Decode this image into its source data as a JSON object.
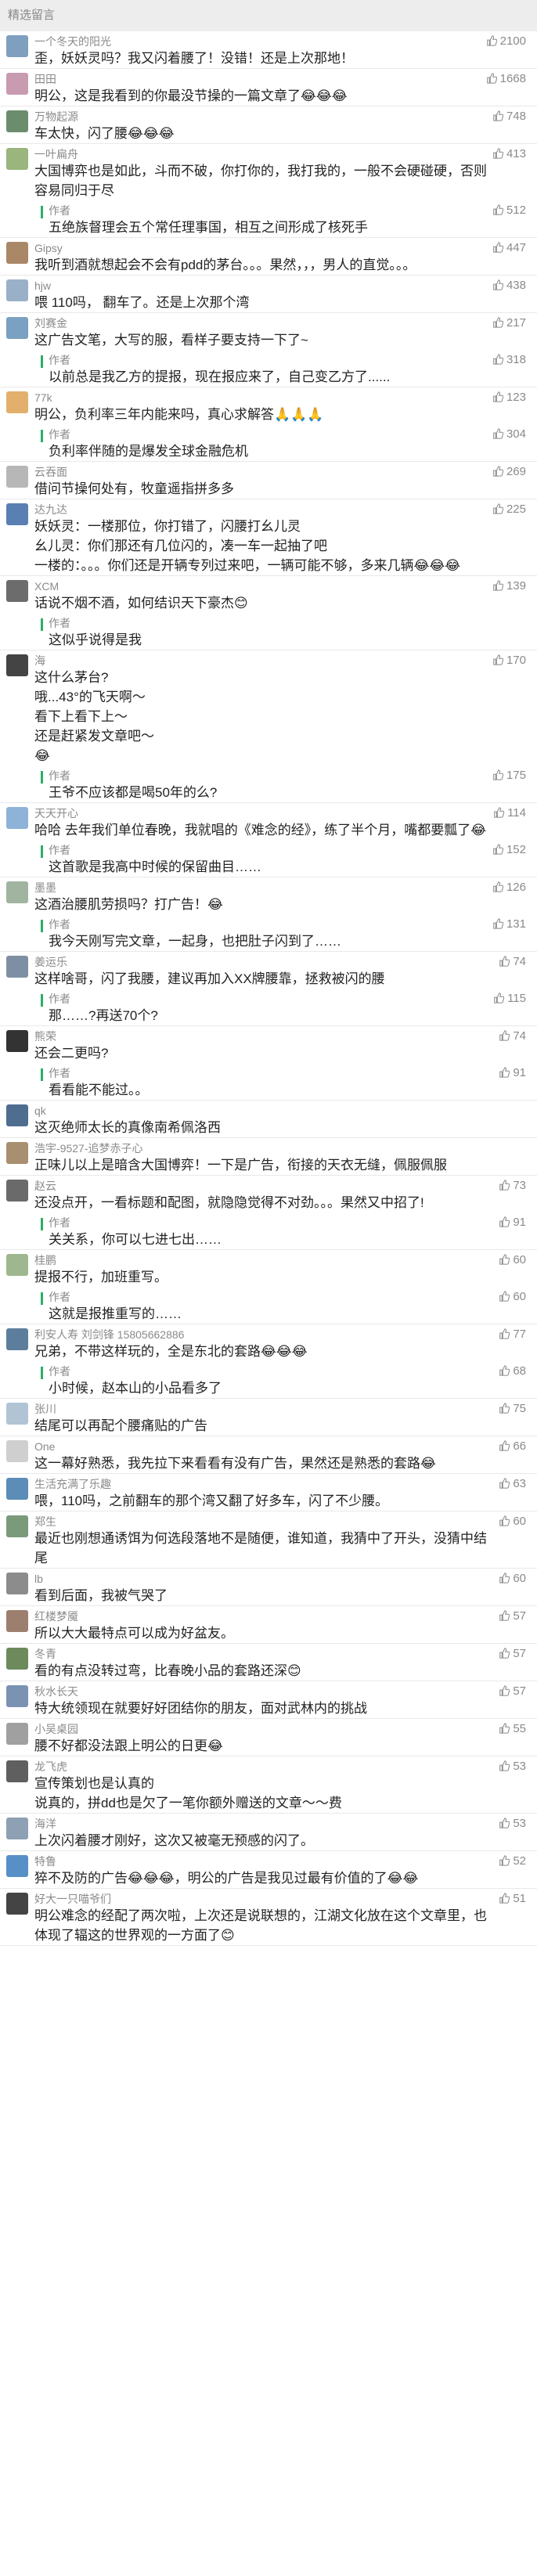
{
  "header": {
    "title": "精选留言"
  },
  "reply_label": "作者",
  "comments": [
    {
      "name": "一个冬天的阳光",
      "likes": "2100",
      "text": "歪，妖妖灵吗？我又闪着腰了！没错！还是上次那地！",
      "avatar": "#7f9fbf"
    },
    {
      "name": "田田",
      "likes": "1668",
      "text": "明公，这是我看到的你最没节操的一篇文章了😂😂😂",
      "avatar": "#c89bb0"
    },
    {
      "name": "万物起源",
      "likes": "748",
      "text": "车太快，闪了腰😂😂😂",
      "avatar": "#6b8d6d"
    },
    {
      "name": "一叶扁舟",
      "likes": "413",
      "text": "大国博弈也是如此，斗而不破，你打你的，我打我的，一般不会硬碰硬，否则容易同归于尽",
      "avatar": "#9ab57d",
      "reply": {
        "likes": "512",
        "text": "五绝族督理会五个常任理事国，相互之间形成了核死手"
      }
    },
    {
      "name": "Gipsy",
      "likes": "447",
      "text": "我听到酒就想起会不会有pdd的茅台。。。果然，，，男人的直觉。。。",
      "avatar": "#aa8766"
    },
    {
      "name": "hjw",
      "likes": "438",
      "text": "喂 110吗， 翻车了。还是上次那个湾",
      "avatar": "#9ab0c8"
    },
    {
      "name": "刘赛金",
      "likes": "217",
      "text": "这广告文笔，大写的服，看样子要支持一下了~",
      "avatar": "#7aa0c2",
      "reply": {
        "likes": "318",
        "text": "以前总是我乙方的提报，现在报应来了，自己变乙方了......"
      }
    },
    {
      "name": "77k",
      "likes": "123",
      "text": "明公，负利率三年内能来吗，真心求解答🙏🙏🙏",
      "avatar": "#e2b06c",
      "reply": {
        "likes": "304",
        "text": "负利率伴随的是爆发全球金融危机"
      }
    },
    {
      "name": "云吞面",
      "likes": "269",
      "text": "借问节操何处有，牧童遥指拼多多",
      "avatar": "#b7b7b7"
    },
    {
      "name": "达九达",
      "likes": "225",
      "text": "妖妖灵：一楼那位，你打错了，闪腰打幺儿灵\n幺儿灵：你们那还有几位闪的，凑一车一起抽了吧\n一楼的：。。。你们还是开辆专列过来吧，一辆可能不够，多来几辆😂😂😂",
      "avatar": "#5a7fb3"
    },
    {
      "name": "XCM",
      "likes": "139",
      "text": "话说不烟不酒，如何结识天下豪杰😊",
      "avatar": "#6c6c6c",
      "reply": {
        "likes": "",
        "text": "这似乎说得是我"
      }
    },
    {
      "name": "海",
      "likes": "170",
      "text": "这什么茅台?\n哦...43°的飞天啊～\n看下上看下上～\n还是赶紧发文章吧～\n😂",
      "avatar": "#444444",
      "reply": {
        "likes": "175",
        "text": "王爷不应该都是喝50年的么?"
      }
    },
    {
      "name": "天天开心",
      "likes": "114",
      "text": "哈哈 去年我们单位春晚，我就唱的《难念的经》，练了半个月，嘴都要瓢了😂",
      "avatar": "#8fb2d8",
      "reply": {
        "likes": "152",
        "text": "这首歌是我高中时候的保留曲目……"
      }
    },
    {
      "name": "墨墨",
      "likes": "126",
      "text": "这酒治腰肌劳损吗？打广告！😂",
      "avatar": "#a0b4a0",
      "reply": {
        "likes": "131",
        "text": "我今天刚写完文章，一起身，也把肚子闪到了……"
      }
    },
    {
      "name": "姜运乐",
      "likes": "74",
      "text": "这样啥哥，闪了我腰，建议再加入XX牌腰靠，拯救被闪的腰",
      "avatar": "#7f8fa3",
      "reply": {
        "likes": "115",
        "text": "那……?再送70个?"
      }
    },
    {
      "name": "熊荣",
      "likes": "74",
      "text": "还会二更吗?",
      "avatar": "#333333",
      "reply": {
        "likes": "91",
        "text": "看看能不能过。。"
      }
    },
    {
      "name": "qk",
      "likes": "",
      "text": "这灭绝师太长的真像南希佩洛西",
      "avatar": "#4f6d8f"
    },
    {
      "name": "浩宇-9527-追梦赤子心",
      "likes": "",
      "text": "正味儿以上是暗含大国博弈！一下是广告，衔接的天衣无缝，佩服佩服",
      "avatar": "#a88f6f"
    },
    {
      "name": "赵云",
      "likes": "73",
      "text": "还没点开，一看标题和配图，就隐隐觉得不对劲。。。果然又中招了!",
      "avatar": "#6a6a6a",
      "reply": {
        "likes": "91",
        "text": "关关系，你可以七进七出……"
      }
    },
    {
      "name": "桂鹏",
      "likes": "60",
      "text": "提报不行，加班重写。",
      "avatar": "#9fb78f",
      "reply": {
        "likes": "60",
        "text": "这就是报推重写的……"
      }
    },
    {
      "name": "利安人寿 刘剑锋 15805662886",
      "likes": "77",
      "text": "兄弟，不带这样玩的，全是东北的套路😂😂😂",
      "avatar": "#5d7d9d",
      "reply": {
        "likes": "68",
        "text": "小时候，赵本山的小品看多了"
      }
    },
    {
      "name": "张川",
      "likes": "75",
      "text": "结尾可以再配个腰痛贴的广告",
      "avatar": "#b0c4d4"
    },
    {
      "name": "One",
      "likes": "66",
      "text": "这一幕好熟悉，我先拉下来看看有没有广告，果然还是熟悉的套路😂",
      "avatar": "#cfcfcf"
    },
    {
      "name": "生活充满了乐趣",
      "likes": "63",
      "text": "喂，110吗，之前翻车的那个湾又翻了好多车，闪了不少腰。",
      "avatar": "#5b8db8"
    },
    {
      "name": "郑生",
      "likes": "60",
      "text": "最近也刚想通诱饵为何选段落地不是随便，谁知道，我猜中了开头，没猜中结尾",
      "avatar": "#7a9a7a"
    },
    {
      "name": "lb",
      "likes": "60",
      "text": "看到后面，我被气哭了",
      "avatar": "#8c8c8c"
    },
    {
      "name": "红楼梦魇",
      "likes": "57",
      "text": "所以大大最特点可以成为好盆友。",
      "avatar": "#9c7f6f"
    },
    {
      "name": "冬青",
      "likes": "57",
      "text": "看的有点没转过弯，比春晚小品的套路还深😊",
      "avatar": "#6d8a5d"
    },
    {
      "name": "秋水长天",
      "likes": "57",
      "text": "特大统领现在就要好好团结你的朋友，面对武林内的挑战",
      "avatar": "#7b93b3"
    },
    {
      "name": "小吴桌园",
      "likes": "55",
      "text": "腰不好都没法跟上明公的日更😂",
      "avatar": "#a0a0a0"
    },
    {
      "name": "龙飞虎",
      "likes": "53",
      "text": "宣传策划也是认真的\n说真的，拼dd也是欠了一笔你额外赠送的文章～～费",
      "avatar": "#5f5f5f"
    },
    {
      "name": "海洋",
      "likes": "53",
      "text": "上次闪着腰才刚好，这次又被毫无预感的闪了。",
      "avatar": "#8ea0b4"
    },
    {
      "name": "特鲁",
      "likes": "52",
      "text": "猝不及防的广告😂😂😂，明公的广告是我见过最有价值的了😂😂",
      "avatar": "#5790c7"
    },
    {
      "name": "好大一只喵爷们",
      "likes": "51",
      "text": "明公难念的经配了两次啦，上次还是说联想的，江湖文化放在这个文章里，也体现了辐这的世界观的一方面了😊",
      "avatar": "#444444"
    }
  ]
}
